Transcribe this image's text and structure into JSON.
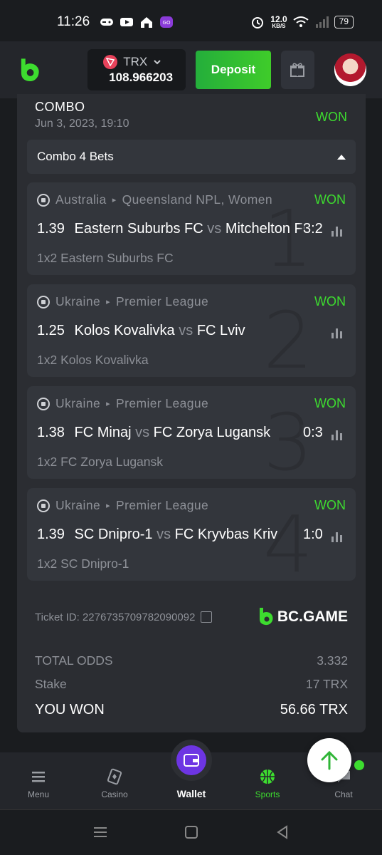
{
  "status_bar": {
    "time": "11:26",
    "net_speed_top": "12.0",
    "net_speed_unit": "KB/S",
    "battery": "79"
  },
  "header": {
    "currency": "TRX",
    "balance": "108.966203",
    "deposit_label": "Deposit",
    "icons": [
      "bc-logo-icon",
      "trx-icon",
      "chevron-down-icon",
      "gift-icon",
      "avatar"
    ]
  },
  "combo": {
    "title": "COMBO",
    "date": "Jun 3, 2023, 19:10",
    "status": "WON",
    "toggle_label": "Combo 4 Bets"
  },
  "bets": [
    {
      "num": "1",
      "country": "Australia",
      "league": "Queensland NPL, Women",
      "status": "WON",
      "odds": "1.39",
      "home": "Eastern Suburbs FC",
      "vs": "vs",
      "away": "Mitchelton FC",
      "score": "3:2",
      "pick": "1x2 Eastern Suburbs FC"
    },
    {
      "num": "2",
      "country": "Ukraine",
      "league": "Premier League",
      "status": "WON",
      "odds": "1.25",
      "home": "Kolos Kovalivka",
      "vs": "vs",
      "away": "FC Lviv",
      "score": "",
      "pick": "1x2 Kolos Kovalivka"
    },
    {
      "num": "3",
      "country": "Ukraine",
      "league": "Premier League",
      "status": "WON",
      "odds": "1.38",
      "home": "FC Minaj",
      "vs": "vs",
      "away": "FC Zorya Lugansk",
      "score": "0:3",
      "pick": "1x2 FC Zorya Lugansk"
    },
    {
      "num": "4",
      "country": "Ukraine",
      "league": "Premier League",
      "status": "WON",
      "odds": "1.39",
      "home": "SC Dnipro-1",
      "vs": "vs",
      "away": "FC Kryvbas Kriv",
      "score": "1:0",
      "pick": "1x2 SC Dnipro-1"
    }
  ],
  "ticket": {
    "id_label": "Ticket ID: 2276735709782090092",
    "brand": "BC.GAME"
  },
  "totals": {
    "total_odds_label": "TOTAL ODDS",
    "total_odds": "3.332",
    "stake_label": "Stake",
    "stake": "17 TRX",
    "won_label": "YOU WON",
    "won": "56.66 TRX"
  },
  "nav": [
    {
      "label": "Menu",
      "icon": "menu-icon"
    },
    {
      "label": "Casino",
      "icon": "casino-icon"
    },
    {
      "label": "Wallet",
      "icon": "wallet-icon"
    },
    {
      "label": "Sports",
      "icon": "basketball-icon"
    },
    {
      "label": "Chat",
      "icon": "chat-icon"
    }
  ],
  "colors": {
    "accent_green": "#3ddc2f",
    "wallet_purple": "#6d35e3",
    "bg": "#1a1c1f",
    "card": "#2b2d32"
  }
}
